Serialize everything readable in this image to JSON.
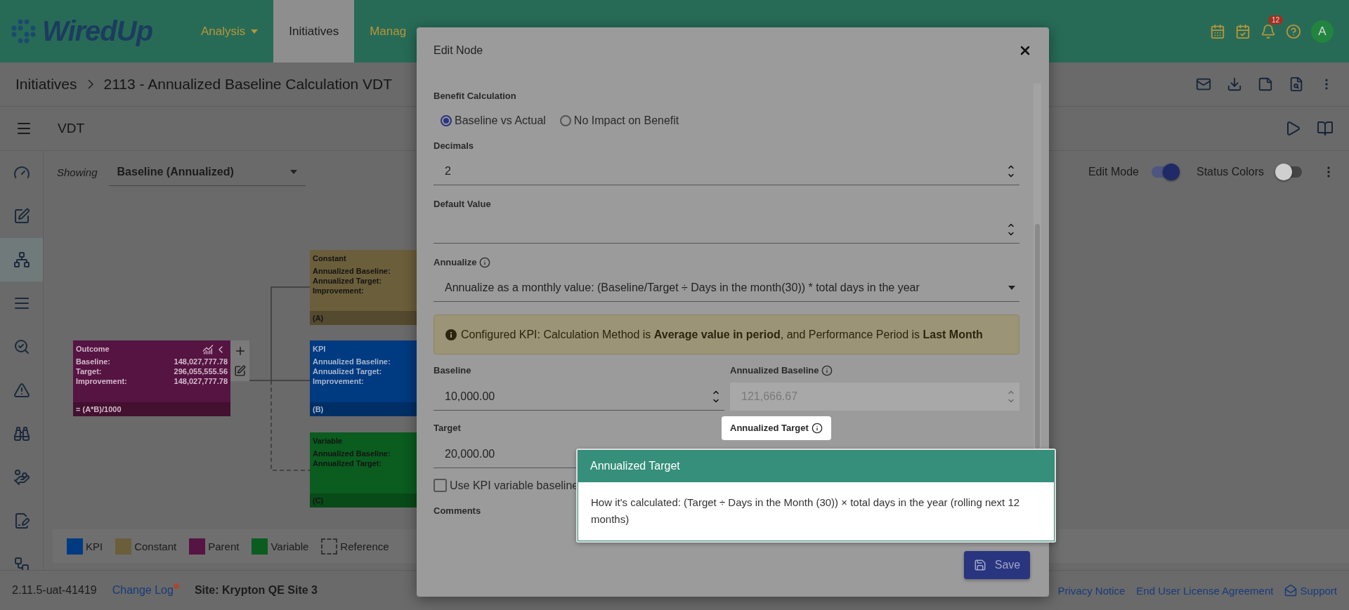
{
  "header": {
    "logo": "WiredUp",
    "nav": [
      {
        "label": "Analysis",
        "selected": false,
        "dropdown": true
      },
      {
        "label": "Initiatives",
        "selected": true
      },
      {
        "label": "Manag",
        "selected": false
      }
    ],
    "notification_count": "12",
    "avatar": "A"
  },
  "breadcrumb": {
    "root": "Initiatives",
    "current": "2113 - Annualized Baseline Calculation VDT"
  },
  "toolbar": {
    "title": "VDT"
  },
  "sidebar": {
    "items": [
      {
        "selected": false
      },
      {
        "selected": false
      },
      {
        "selected": true
      },
      {
        "selected": false
      },
      {
        "selected": false
      },
      {
        "selected": false
      },
      {
        "selected": false
      },
      {
        "selected": false
      },
      {
        "selected": false
      },
      {
        "selected": false
      }
    ]
  },
  "canvas": {
    "showing_label": "Showing",
    "showing_value": "Baseline (Annualized)",
    "edit_mode": {
      "label": "Edit Mode",
      "on": true
    },
    "status_colors": {
      "label": "Status Colors",
      "on": false
    },
    "nodes": [
      {
        "kind": "parent",
        "title": "Outcome",
        "rows": [
          {
            "label": "Baseline:",
            "value": "148,027,777.78"
          },
          {
            "label": "Target:",
            "value": "296,055,555.56"
          },
          {
            "label": "Improvement:",
            "value": "148,027,777.78"
          }
        ],
        "footer": "= (A*B)/1000"
      },
      {
        "kind": "constant",
        "title": "Constant",
        "rows": [
          {
            "label": "Annualized Baseline:"
          },
          {
            "label": "Annualized Target:"
          },
          {
            "label": "Improvement:"
          }
        ],
        "footer": "(A)"
      },
      {
        "kind": "kpi",
        "title": "KPI",
        "rows": [
          {
            "label": "Annualized Baseline:"
          },
          {
            "label": "Annualized Target:"
          },
          {
            "label": "Improvement:"
          }
        ],
        "footer": "(B)"
      },
      {
        "kind": "variable",
        "title": "Variable",
        "rows": [
          {
            "label": "Annualized Baseline:"
          },
          {
            "label": "Annualized Target:"
          }
        ],
        "footer": "(C)"
      }
    ],
    "legend": [
      {
        "kind": "kpi",
        "label": "KPI"
      },
      {
        "kind": "constant",
        "label": "Constant"
      },
      {
        "kind": "parent",
        "label": "Parent"
      },
      {
        "kind": "variable",
        "label": "Variable"
      },
      {
        "kind": "reference",
        "label": "Reference"
      }
    ]
  },
  "modal": {
    "title": "Edit Node",
    "benefit_calculation": {
      "label": "Benefit Calculation",
      "options": [
        {
          "label": "Baseline vs Actual",
          "selected": true
        },
        {
          "label": "No Impact on Benefit",
          "selected": false
        }
      ]
    },
    "decimals": {
      "label": "Decimals",
      "value": "2"
    },
    "default_value": {
      "label": "Default Value"
    },
    "annualize": {
      "label": "Annualize",
      "value": "Annualize as a monthly value: (Baseline/Target ÷ Days in the month(30)) * total days in the year"
    },
    "alert": "Configured KPI: Calculation Method is **Average value in period**, and Performance Period is **Last Month**",
    "baseline": {
      "label": "Baseline",
      "value": "10,000.00"
    },
    "annualized_baseline": {
      "label": "Annualized Baseline",
      "value": "121,666.67",
      "disabled": true
    },
    "target": {
      "label": "Target",
      "value": "20,000.00"
    },
    "annualized_target": {
      "label": "Annualized Target"
    },
    "use_kpi_checkbox": {
      "label": "Use KPI variable baseline",
      "checked": false
    },
    "comments": {
      "label": "Comments"
    },
    "save": "Save"
  },
  "tooltip": {
    "title": "Annualized Target",
    "body": "How it's calculated: (Target ÷ Days in the Month (30)) × total days in the year (rolling next 12 months)"
  },
  "footer": {
    "version": "2.11.5-uat-41419",
    "change_log": "Change Log",
    "site": "Site: Krypton QE Site 3",
    "links": [
      "Privacy Notice",
      "End User License Agreement"
    ],
    "support": "Support"
  }
}
